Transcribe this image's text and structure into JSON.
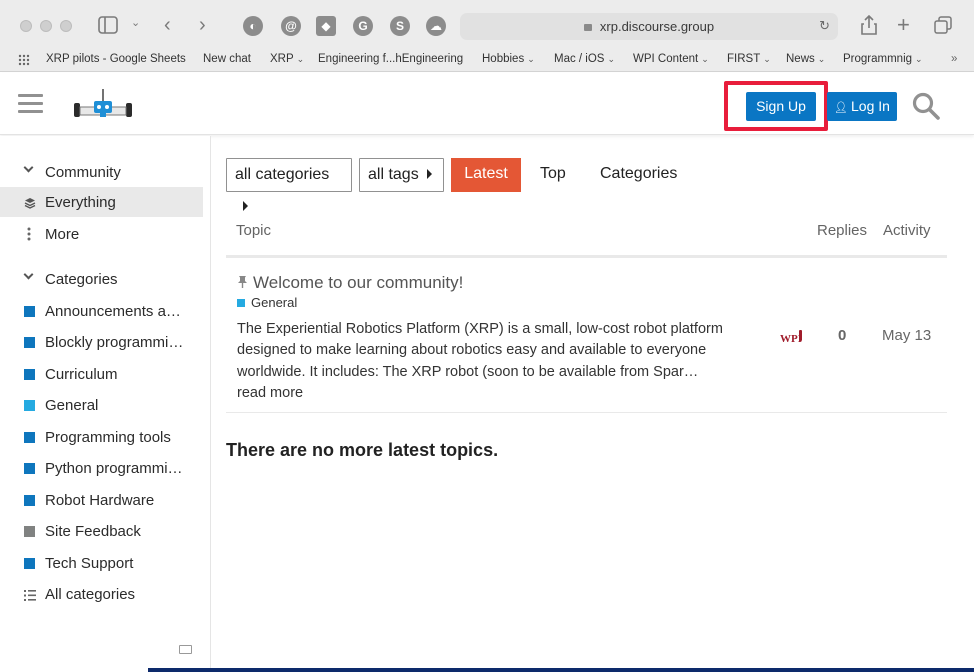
{
  "browser": {
    "url": "xrp.discourse.group",
    "bookmarks": [
      {
        "label": "XRP pilots - Google Sheets",
        "has_menu": false
      },
      {
        "label": "New chat",
        "has_menu": false
      },
      {
        "label": "XRP",
        "has_menu": true
      },
      {
        "label": "Engineering f...hEngineering",
        "has_menu": false
      },
      {
        "label": "Hobbies",
        "has_menu": true
      },
      {
        "label": "Mac / iOS",
        "has_menu": true
      },
      {
        "label": "WPI Content",
        "has_menu": true
      },
      {
        "label": "FIRST",
        "has_menu": true
      },
      {
        "label": "News",
        "has_menu": true
      },
      {
        "label": "Programmnig",
        "has_menu": true
      }
    ],
    "ext_icons": [
      "shield-icon",
      "at-sign-icon",
      "mask-icon",
      "g-icon",
      "s-icon",
      "cloud-person-icon"
    ]
  },
  "header": {
    "signup_label": "Sign Up",
    "login_label": "Log In",
    "accent_color": "#0a76c4",
    "highlight_color": "#e81d3b"
  },
  "sidebar": {
    "community_heading": "Community",
    "everything": "Everything",
    "more": "More",
    "categories_heading": "Categories",
    "categories": [
      {
        "label": "Announcements a…",
        "color": "#0e76bd"
      },
      {
        "label": "Blockly programmi…",
        "color": "#0e76bd"
      },
      {
        "label": "Curriculum",
        "color": "#0e76bd"
      },
      {
        "label": "General",
        "color": "#25aae1"
      },
      {
        "label": "Programming tools",
        "color": "#0e76bd"
      },
      {
        "label": "Python programmi…",
        "color": "#0e76bd"
      },
      {
        "label": "Robot Hardware",
        "color": "#0e76bd"
      },
      {
        "label": "Site Feedback",
        "color": "#808281"
      },
      {
        "label": "Tech Support",
        "color": "#0e76bd"
      }
    ],
    "all_categories": "All categories"
  },
  "main": {
    "filters": {
      "categories_dropdown": "all categories",
      "tags_dropdown": "all tags",
      "tabs": [
        "Latest",
        "Top",
        "Categories"
      ],
      "active_tab": "Latest",
      "active_color": "#e45735"
    },
    "columns": {
      "topic": "Topic",
      "replies": "Replies",
      "activity": "Activity"
    },
    "topics": [
      {
        "title": "Welcome to our community!",
        "category": "General",
        "excerpt": "The Experiential Robotics Platform (XRP) is a small, low-cost robot platform designed to make learning about robotics easy and available to everyone worldwide. It includes: The XRP robot (soon to be available from Spar…",
        "read_more": "read more",
        "replies": "0",
        "activity": "May 13"
      }
    ],
    "no_more": "There are no more latest topics."
  }
}
